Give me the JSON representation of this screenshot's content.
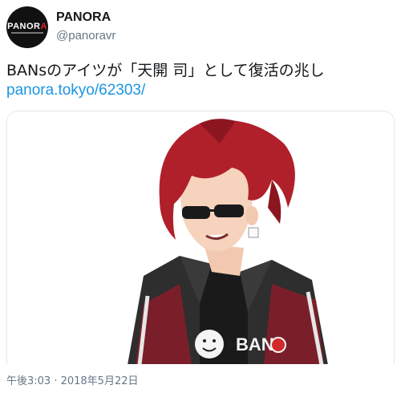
{
  "account": {
    "display_name": "PANORA",
    "handle": "@panoravr",
    "avatar_text_white": "PANOR",
    "avatar_text_red": "A"
  },
  "tweet": {
    "text": "BANsのアイツが「天開 司」として復活の兆し",
    "link": "panora.tokyo/62303/",
    "timestamp": "午後3:03 · 2018年5月22日"
  },
  "media": {
    "jacket_logo": "BAN",
    "icon": "anime-character-illustration"
  },
  "colors": {
    "link": "#1b95e0",
    "secondary_text": "#657786",
    "hair": "#b0202a",
    "jacket": "#2e2e2e",
    "jacket_accent": "#7a1f2a"
  }
}
